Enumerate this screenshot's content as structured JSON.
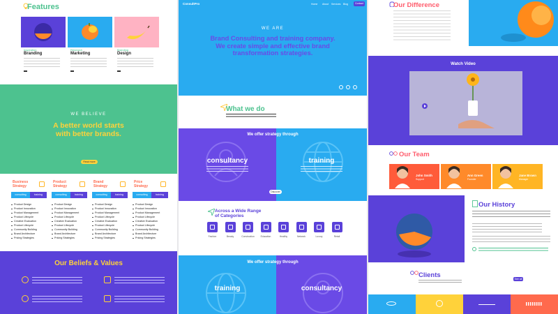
{
  "left": {
    "features": {
      "title": "Features",
      "cards": [
        {
          "category": "Inspiration",
          "title": "Branding"
        },
        {
          "category": "Research",
          "title": "Marketing"
        },
        {
          "category": "Branding",
          "title": "Design"
        }
      ]
    },
    "believe": {
      "eyebrow": "WE BELIEVE",
      "headline_1": "A better world starts",
      "headline_2": "with better brands.",
      "button": "Read more"
    },
    "pricing": {
      "plans": [
        {
          "title_1": "Business",
          "title_2": "Strategy",
          "color": "#ff6a4d"
        },
        {
          "title_1": "Product",
          "title_2": "Strategy",
          "color": "#ff6a4d"
        },
        {
          "title_1": "Brand",
          "title_2": "Strategy",
          "color": "#ff6a4d"
        },
        {
          "title_1": "Price",
          "title_2": "Strategy",
          "color": "#ff6a4d"
        }
      ],
      "tab_consulting": "consulting",
      "tab_training": "training",
      "items": [
        "Product Design",
        "Product Innovation",
        "Product Management",
        "Product Lifecycle",
        "Creative Evaluation",
        "Product Lifecycle",
        "Community Building",
        "Brand Architecture",
        "Pricing Strategies"
      ]
    },
    "beliefs": {
      "title": "Our Beliefs & Values"
    }
  },
  "mid": {
    "nav": {
      "logo": "ConsultPro",
      "links": [
        "Home",
        "About",
        "Services",
        "Blog"
      ],
      "contact": "Contact"
    },
    "hero": {
      "eyebrow": "WE ARE",
      "line_1": "Brand Consulting and training company.",
      "line_2": "We create simple and effective brand",
      "line_3": "transformation strategies."
    },
    "what_we_do": {
      "title": "What we do"
    },
    "strategy": {
      "heading": "We offer strategy through",
      "left": "consultancy",
      "right": "training",
      "button": "Discover"
    },
    "categories": {
      "title_1": "Across a Wide Range",
      "title_2": "of Categories",
      "items": [
        "Fashion",
        "Beauty",
        "Construction",
        "Education",
        "Healthy",
        "Network",
        "Luxury",
        "Retail"
      ]
    },
    "strategy2": {
      "heading": "We offer strategy through",
      "left": "training",
      "right": "consultancy"
    }
  },
  "right": {
    "difference": {
      "title": "Our Difference"
    },
    "video": {
      "title": "Watch Video"
    },
    "team": {
      "title": "Our Team",
      "members": [
        {
          "name": "John Smith",
          "role": "Support",
          "color": "#ff5b3a"
        },
        {
          "name": "Ann Green",
          "role": "Founder",
          "color": "#ff8a2a"
        },
        {
          "name": "Jane Brown",
          "role": "Manager",
          "color": "#ffb524"
        }
      ]
    },
    "history": {
      "title": "Our History"
    },
    "clients": {
      "title": "Clients",
      "button": "See all"
    }
  },
  "colors": {
    "purple": "#5a41d9",
    "blue": "#29abf0",
    "green": "#4dc28f",
    "orange": "#ff6a4d",
    "yellow": "#ffd23a",
    "coral": "#ff5b6b"
  }
}
